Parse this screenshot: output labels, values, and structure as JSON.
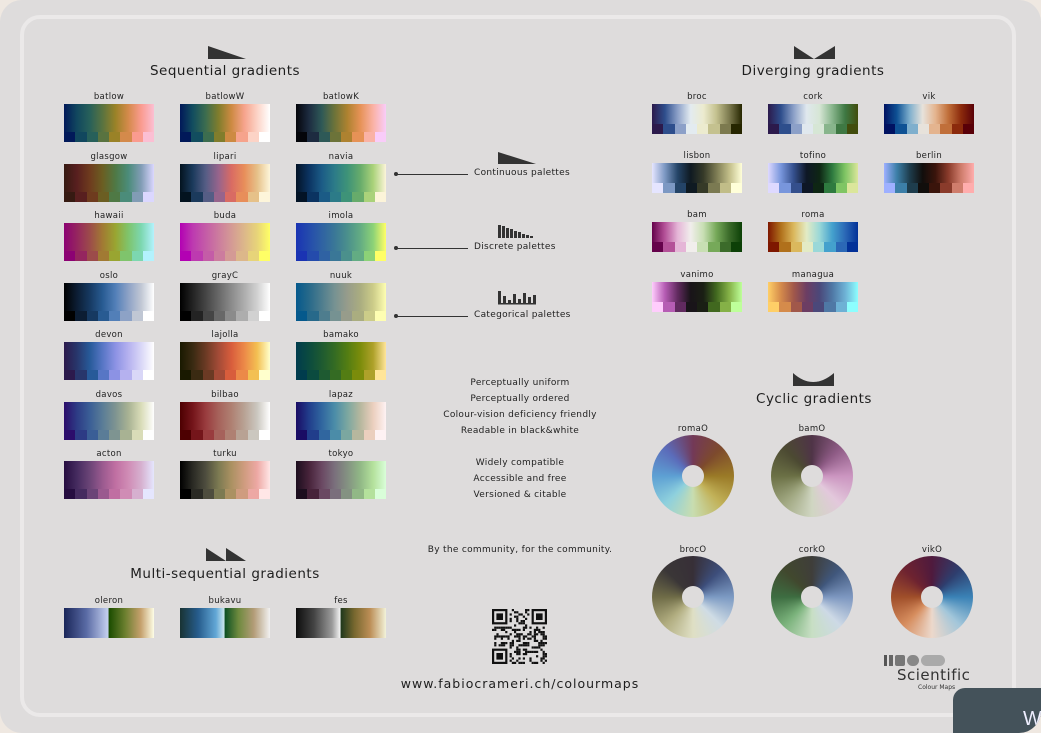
{
  "sections": {
    "sequential": "Sequential gradients",
    "diverging": "Diverging gradients",
    "cyclic": "Cyclic gradients",
    "multi": "Multi-sequential gradients"
  },
  "legend": [
    "Continuous palettes",
    "Discrete palettes",
    "Categorical palettes"
  ],
  "features": [
    "Perceptually uniform",
    "Perceptually ordered",
    "Colour-vision deficiency friendly",
    "Readable in black&white",
    "Widely compatible",
    "Accessible and free",
    "Versioned & citable"
  ],
  "community": "By the community, for the community.",
  "url": "www.fabiocrameri.ch/colourmaps",
  "logo": {
    "title": "Scientific",
    "subtitle": "Colour Maps"
  },
  "corner_text": "W",
  "sequential": [
    {
      "name": "batlow",
      "colors": [
        "#011959",
        "#11475e",
        "#27605a",
        "#597340",
        "#9a8227",
        "#d48a4b",
        "#fa9b8f",
        "#fbbfd3"
      ]
    },
    {
      "name": "batlowW",
      "colors": [
        "#011959",
        "#124d5f",
        "#3c6d4f",
        "#817d2c",
        "#cd8a42",
        "#f6a38c",
        "#fcd3c6",
        "#ffffff"
      ]
    },
    {
      "name": "batlowK",
      "colors": [
        "#04050a",
        "#1d2b40",
        "#2e5957",
        "#6c7339",
        "#ae8230",
        "#e69256",
        "#fab2a5",
        "#f9ccf9"
      ]
    },
    {
      "name": "glasgow",
      "colors": [
        "#361a12",
        "#581f1f",
        "#6e3b1e",
        "#6b5e22",
        "#4f7945",
        "#4b8c7a",
        "#819cb5",
        "#dbd7ff"
      ]
    },
    {
      "name": "lipari",
      "colors": [
        "#03131f",
        "#1b3a5c",
        "#555d85",
        "#97648c",
        "#d96b63",
        "#e88e5a",
        "#e6c189",
        "#fdf5da"
      ]
    },
    {
      "name": "navia",
      "colors": [
        "#031326",
        "#0b3361",
        "#1b5b86",
        "#2c7b88",
        "#3e9378",
        "#67ab6b",
        "#aad27a",
        "#fcf4d9"
      ]
    },
    {
      "name": "hawaii",
      "colors": [
        "#8c0273",
        "#95255f",
        "#9c4b4a",
        "#a17a33",
        "#99a531",
        "#7fc46c",
        "#7cd7b0",
        "#b3f2fd"
      ]
    },
    {
      "name": "buda",
      "colors": [
        "#b301b3",
        "#bd3ab0",
        "#c45ca7",
        "#cc7c9e",
        "#d49a95",
        "#dcb78a",
        "#e7d479",
        "#ffff66"
      ]
    },
    {
      "name": "imola",
      "colors": [
        "#1a33b3",
        "#244bac",
        "#2f62a3",
        "#3a7797",
        "#4b908c",
        "#63ac83",
        "#8cd277",
        "#ffff66"
      ]
    },
    {
      "name": "oslo",
      "colors": [
        "#010101",
        "#0c1d33",
        "#163961",
        "#285b92",
        "#527fb8",
        "#8da2c6",
        "#c0c7d4",
        "#ffffff"
      ]
    },
    {
      "name": "grayC",
      "colors": [
        "#000000",
        "#232323",
        "#454545",
        "#686868",
        "#8b8b8b",
        "#adadad",
        "#d1d1d1",
        "#ffffff"
      ]
    },
    {
      "name": "nuuk",
      "colors": [
        "#05598c",
        "#27698a",
        "#4e7d8e",
        "#769292",
        "#979c8b",
        "#aaad80",
        "#cccc89",
        "#fefeb2"
      ]
    },
    {
      "name": "devon",
      "colors": [
        "#2c1a4c",
        "#28366b",
        "#275a99",
        "#5776c5",
        "#8c92e4",
        "#b5b1ef",
        "#d9d7f7",
        "#ffffff"
      ]
    },
    {
      "name": "lajolla",
      "colors": [
        "#191900",
        "#3a2a12",
        "#6b3a24",
        "#a34b37",
        "#d85d3c",
        "#ec8948",
        "#f3c052",
        "#ffffcc"
      ]
    },
    {
      "name": "bamako",
      "colors": [
        "#003c4d",
        "#0b4b3f",
        "#1e5a31",
        "#346b23",
        "#537d13",
        "#7b8c0b",
        "#aea12a",
        "#ffe599"
      ]
    },
    {
      "name": "davos",
      "colors": [
        "#2c0d6b",
        "#2d3b85",
        "#3a5e96",
        "#5a7c97",
        "#7e9491",
        "#a8b293",
        "#d9dcb8",
        "#fefefe"
      ]
    },
    {
      "name": "bilbao",
      "colors": [
        "#4d0001",
        "#74151a",
        "#993c3e",
        "#a6625b",
        "#af8072",
        "#b8a294",
        "#cbc7bf",
        "#ffffff"
      ]
    },
    {
      "name": "lapaz",
      "colors": [
        "#1a0c64",
        "#213d8b",
        "#30669f",
        "#4b8ca8",
        "#7ba7a0",
        "#b6b79e",
        "#ebcfbe",
        "#fef2f3"
      ]
    },
    {
      "name": "acton",
      "colors": [
        "#260d40",
        "#452b5f",
        "#6b4477",
        "#9a5a8f",
        "#c06fa2",
        "#d08cb5",
        "#d6b0cf",
        "#e5e6fe"
      ]
    },
    {
      "name": "turku",
      "colors": [
        "#000000",
        "#2a2a24",
        "#4e4d3e",
        "#7c7a52",
        "#ab9162",
        "#cf9c7f",
        "#eda8a4",
        "#ffe6e6"
      ]
    },
    {
      "name": "tokyo",
      "colors": [
        "#1c0e1e",
        "#47233a",
        "#6a4862",
        "#7a6f7c",
        "#849282",
        "#91b886",
        "#b4e19c",
        "#d9fed9"
      ]
    }
  ],
  "diverging": [
    {
      "name": "broc",
      "colors": [
        "#2c1a4c",
        "#2e4e8c",
        "#8ca0c8",
        "#e3ebf0",
        "#ecebcf",
        "#c4c18f",
        "#7c7a4f",
        "#262600"
      ]
    },
    {
      "name": "cork",
      "colors": [
        "#2c1a4c",
        "#2e4e8c",
        "#8ca0c8",
        "#e0e8ee",
        "#d6e6d5",
        "#88b58c",
        "#3e7843",
        "#424d0d"
      ]
    },
    {
      "name": "vik",
      "colors": [
        "#001261",
        "#0e5194",
        "#7fafcd",
        "#e7e2db",
        "#e4b48f",
        "#c06f3a",
        "#8b2a0c",
        "#590008"
      ]
    },
    {
      "name": "lisbon",
      "colors": [
        "#e5e5ff",
        "#7c98c3",
        "#244467",
        "#0f1a22",
        "#363a28",
        "#7b7a52",
        "#c1bd88",
        "#ffffd9"
      ]
    },
    {
      "name": "tofino",
      "colors": [
        "#ded9ff",
        "#7896dc",
        "#344f8c",
        "#0e1726",
        "#0e2614",
        "#2e7a3f",
        "#7fc564",
        "#dbe69b"
      ]
    },
    {
      "name": "berlin",
      "colors": [
        "#9eb0ff",
        "#3c7fa8",
        "#1e3d4d",
        "#110e0c",
        "#3a140b",
        "#8a3b2b",
        "#cf7d6c",
        "#ffadad"
      ]
    },
    {
      "name": "bam",
      "colors": [
        "#65024b",
        "#b45198",
        "#e5b5d7",
        "#f1eeec",
        "#c8dfb3",
        "#76a959",
        "#3b6b2a",
        "#0c4007"
      ]
    },
    {
      "name": "roma",
      "colors": [
        "#7e1700",
        "#b0701b",
        "#dbb85d",
        "#e3ebc5",
        "#9ad8d8",
        "#44a1cd",
        "#2b68b6",
        "#023198"
      ]
    },
    {
      "name": "vanimo",
      "colors": [
        "#ffcdfd",
        "#b65db4",
        "#612a5f",
        "#191419",
        "#1a1f14",
        "#41681f",
        "#85b147",
        "#beff9a"
      ]
    },
    {
      "name": "managua",
      "colors": [
        "#ffcf67",
        "#d58b4b",
        "#a1584a",
        "#6c3d63",
        "#4b487a",
        "#4f78a5",
        "#6eb1d5",
        "#8dfefe"
      ]
    }
  ],
  "multi": [
    {
      "name": "oleron",
      "stops": "linear-gradient(90deg,#1a2659 0%,#5a6ba5 25%,#c5d0ef 49%,#1a4c00 50%,#6c7f2f 68%,#c49f6b 85%,#fdfde6 100%)",
      "colors": [
        "#1a2659",
        "#4d5d98",
        "#8895cf",
        "#c5d0ef",
        "#365e00",
        "#86873f",
        "#d3a77b",
        "#fdfde6"
      ]
    },
    {
      "name": "bukavu",
      "stops": "linear-gradient(90deg,#193333 0%,#265c8c 20%,#62a7d6 40%,#c9e5ec 49%,#0d5023 50%,#6e8a3e 65%,#b39c78 82%,#f1f1f1 100%)",
      "colors": [
        "#193333",
        "#2e6a9b",
        "#6aafd9",
        "#d1ecf2",
        "#1a5c20",
        "#7d8b4a",
        "#b8a388",
        "#f1f1f1"
      ]
    },
    {
      "name": "fes",
      "stops": "linear-gradient(90deg,#0d0d0d 0%,#444444 20%,#9a9a9a 40%,#f2f2f2 49%,#20381c 50%,#78682f 65%,#bb8d55 82%,#f2f2d9 100%)",
      "colors": [
        "#0d0d0d",
        "#4a4a4a",
        "#a0a0a0",
        "#f2f2f2",
        "#2e4a21",
        "#7e6d38",
        "#c29b6b",
        "#f2f2d9"
      ]
    }
  ],
  "cyclic": [
    {
      "name": "romaO",
      "colors": [
        "#733957",
        "#7d4a2d",
        "#9a7a27",
        "#c2b259",
        "#c8ddb0",
        "#8ed0dd",
        "#5da0d3",
        "#5b6cba",
        "#733957"
      ]
    },
    {
      "name": "bamO",
      "colors": [
        "#4f3447",
        "#8e5b85",
        "#cb95c0",
        "#e3c8dc",
        "#d0d6c2",
        "#a1a882",
        "#6b7045",
        "#4c4a32",
        "#4f3447"
      ]
    },
    {
      "name": "brocO",
      "colors": [
        "#372f37",
        "#3d4e7b",
        "#7c9ac3",
        "#cfdce5",
        "#dfdfc4",
        "#b1ad80",
        "#6f6c47",
        "#3a3637",
        "#372f37"
      ]
    },
    {
      "name": "corkO",
      "colors": [
        "#3f3e3a",
        "#40577c",
        "#7d97c0",
        "#cdd9e6",
        "#c8dfc4",
        "#7ab27b",
        "#3d6d41",
        "#41482e",
        "#3f3e3a"
      ]
    },
    {
      "name": "vikO",
      "colors": [
        "#4f1a3d",
        "#2e3e6e",
        "#3a82b6",
        "#a2c6da",
        "#ecd8cb",
        "#d68d5e",
        "#a04f2a",
        "#6e2330",
        "#4f1a3d"
      ]
    }
  ]
}
